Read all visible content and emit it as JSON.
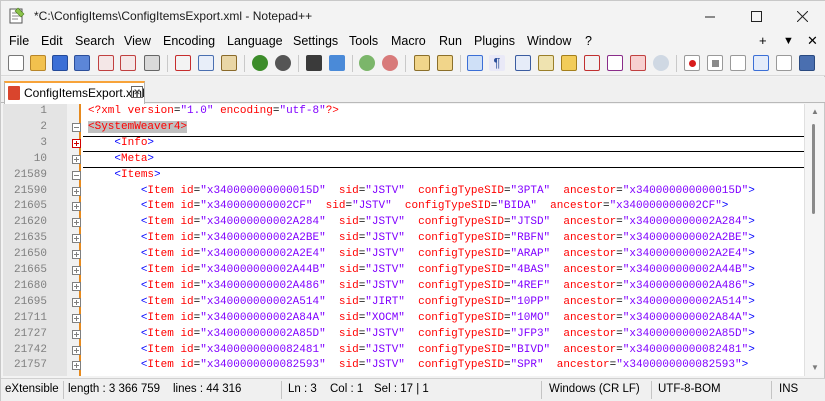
{
  "window": {
    "title": "*C:\\ConfigItems\\ConfigItemsExport.xml - Notepad++"
  },
  "menu": {
    "items": [
      "File",
      "Edit",
      "Search",
      "View",
      "Encoding",
      "Language",
      "Settings",
      "Tools",
      "Macro",
      "Run",
      "Plugins",
      "Window",
      "?"
    ],
    "right": [
      "+",
      "▼",
      "✕"
    ]
  },
  "tab": {
    "label": "ConfigItemsExport.xml",
    "close": "✕"
  },
  "editor": {
    "lines": [
      {
        "num": "1",
        "fold": "none",
        "text": "<?xml version=\"1.0\" encoding=\"utf-8\"?>",
        "kind": "pi"
      },
      {
        "num": "2",
        "fold": "minus",
        "text": "<SystemWeaver4>",
        "kind": "root"
      },
      {
        "num": "3",
        "fold": "plus-red",
        "text": "    <Info>",
        "kind": "tag"
      },
      {
        "num": "10",
        "fold": "plus",
        "text": "    <Meta>",
        "kind": "tag"
      },
      {
        "num": "21589",
        "fold": "minus",
        "text": "    <Items>",
        "kind": "tag"
      },
      {
        "num": "21590",
        "fold": "plus",
        "id": "x340000000000015D",
        "sid": "JSTV",
        "cts": "3PTA",
        "anc": "x340000000000015D"
      },
      {
        "num": "21605",
        "fold": "plus",
        "id": "x340000000002CF",
        "sid": "JSTV",
        "cts": "BIDA",
        "anc": "x340000000002CF"
      },
      {
        "num": "21620",
        "fold": "plus",
        "id": "x340000000002A284",
        "sid": "JSTV",
        "cts": "JTSD",
        "anc": "x340000000002A284"
      },
      {
        "num": "21635",
        "fold": "plus",
        "id": "x340000000002A2BE",
        "sid": "JSTV",
        "cts": "RBFN",
        "anc": "x340000000002A2BE"
      },
      {
        "num": "21650",
        "fold": "plus",
        "id": "x340000000002A2E4",
        "sid": "JSTV",
        "cts": "ARAP",
        "anc": "x340000000002A2E4"
      },
      {
        "num": "21665",
        "fold": "plus",
        "id": "x340000000002A44B",
        "sid": "JSTV",
        "cts": "4BAS",
        "anc": "x340000000002A44B"
      },
      {
        "num": "21680",
        "fold": "plus",
        "id": "x340000000002A486",
        "sid": "JSTV",
        "cts": "4REF",
        "anc": "x340000000002A486"
      },
      {
        "num": "21695",
        "fold": "plus",
        "id": "x340000000002A514",
        "sid": "JIRT",
        "cts": "10PP",
        "anc": "x340000000002A514"
      },
      {
        "num": "21711",
        "fold": "plus",
        "id": "x340000000002A84A",
        "sid": "XOCM",
        "cts": "10MO",
        "anc": "x340000000002A84A"
      },
      {
        "num": "21727",
        "fold": "plus",
        "id": "x340000000002A85D",
        "sid": "JSTV",
        "cts": "JFP3",
        "anc": "x340000000002A85D"
      },
      {
        "num": "21742",
        "fold": "plus",
        "id": "x3400000000082481",
        "sid": "JSTV",
        "cts": "BIVD",
        "anc": "x3400000000082481"
      },
      {
        "num": "21757",
        "fold": "plus",
        "id": "x3400000000082593",
        "sid": "JSTV",
        "cts": "SPR",
        "anc": "x3400000000082593"
      }
    ]
  },
  "status": {
    "type": "eXtensible Markup Language file",
    "length": "length : 3 366 759",
    "lines": "lines : 44 316",
    "ln": "Ln : 3",
    "col": "Col : 1",
    "sel": "Sel : 17 | 1",
    "eol": "Windows (CR LF)",
    "encoding": "UTF-8-BOM",
    "ins": "INS"
  },
  "colors": {
    "accent_orange": "#e68a1e",
    "tag_blue": "#0000ff",
    "attr_red": "#ff0000",
    "value_purple": "#8000ff"
  }
}
